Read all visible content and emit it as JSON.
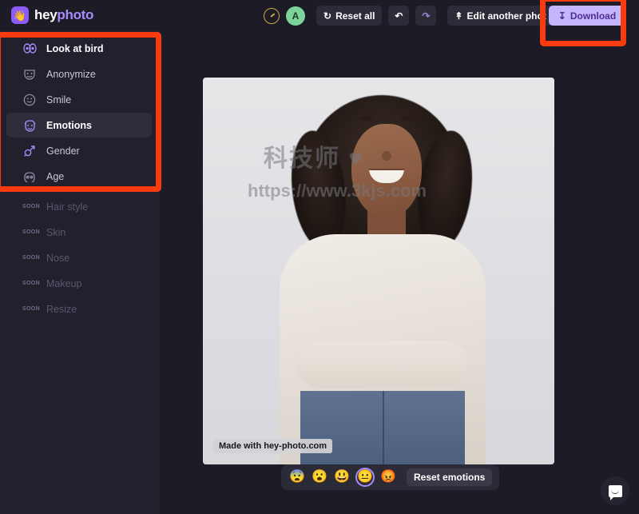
{
  "app": {
    "brand_primary": "hey",
    "brand_secondary": "photo",
    "logo_icon": "waving-hand-icon",
    "accent_color": "#8b5cf6",
    "bg_color": "#1c1b26",
    "annotation_color": "#fa3b10"
  },
  "toolbar": {
    "credits_icon": "credits-meter-icon",
    "avatar_initial": "A",
    "reset_all_label": "Reset all",
    "reset_all_icon": "refresh-icon",
    "undo_icon": "undo-arrow-icon",
    "redo_icon": "redo-arrow-icon",
    "edit_another_label": "Edit another phot",
    "edit_another_icon": "upload-icon",
    "download_label": "Download",
    "download_icon": "download-icon"
  },
  "sidebar": {
    "items": [
      {
        "label": "Look at bird",
        "icon": "eyes-icon",
        "state": "enabled",
        "badge": ""
      },
      {
        "label": "Anonymize",
        "icon": "theater-mask-icon",
        "state": "enabled",
        "badge": ""
      },
      {
        "label": "Smile",
        "icon": "smiley-icon",
        "state": "enabled",
        "badge": ""
      },
      {
        "label": "Emotions",
        "icon": "emotion-face-icon",
        "state": "active",
        "badge": ""
      },
      {
        "label": "Gender",
        "icon": "gender-icon",
        "state": "enabled",
        "badge": ""
      },
      {
        "label": "Age",
        "icon": "age-face-icon",
        "state": "enabled",
        "badge": ""
      },
      {
        "label": "Hair style",
        "icon": "hair-icon",
        "state": "soon",
        "badge": "SOON"
      },
      {
        "label": "Skin",
        "icon": "skin-icon",
        "state": "soon",
        "badge": "SOON"
      },
      {
        "label": "Nose",
        "icon": "nose-icon",
        "state": "soon",
        "badge": "SOON"
      },
      {
        "label": "Makeup",
        "icon": "makeup-icon",
        "state": "soon",
        "badge": "SOON"
      },
      {
        "label": "Resize",
        "icon": "resize-icon",
        "state": "soon",
        "badge": "SOON"
      }
    ]
  },
  "canvas": {
    "photo_caption": "Made with hey-photo.com",
    "watermark_line1": "科技师 ♥",
    "watermark_line2": "https://www.3kjs.com",
    "photo_alt": "portrait-of-smiling-woman-with-curly-hair-arms-crossed"
  },
  "emotion_bar": {
    "emotions": [
      {
        "name": "fear",
        "glyph": "😨",
        "selected": false
      },
      {
        "name": "surprise",
        "glyph": "😮",
        "selected": false
      },
      {
        "name": "happy",
        "glyph": "😃",
        "selected": false
      },
      {
        "name": "neutral",
        "glyph": "😐",
        "selected": true
      },
      {
        "name": "anger",
        "glyph": "😡",
        "selected": false
      }
    ],
    "reset_label": "Reset emotions"
  },
  "chat": {
    "icon": "chat-bubble-icon"
  },
  "annotations": [
    {
      "name": "sidebar-tools-highlight",
      "target": "sidebar-menu"
    },
    {
      "name": "download-button-highlight",
      "target": "download-button"
    }
  ]
}
